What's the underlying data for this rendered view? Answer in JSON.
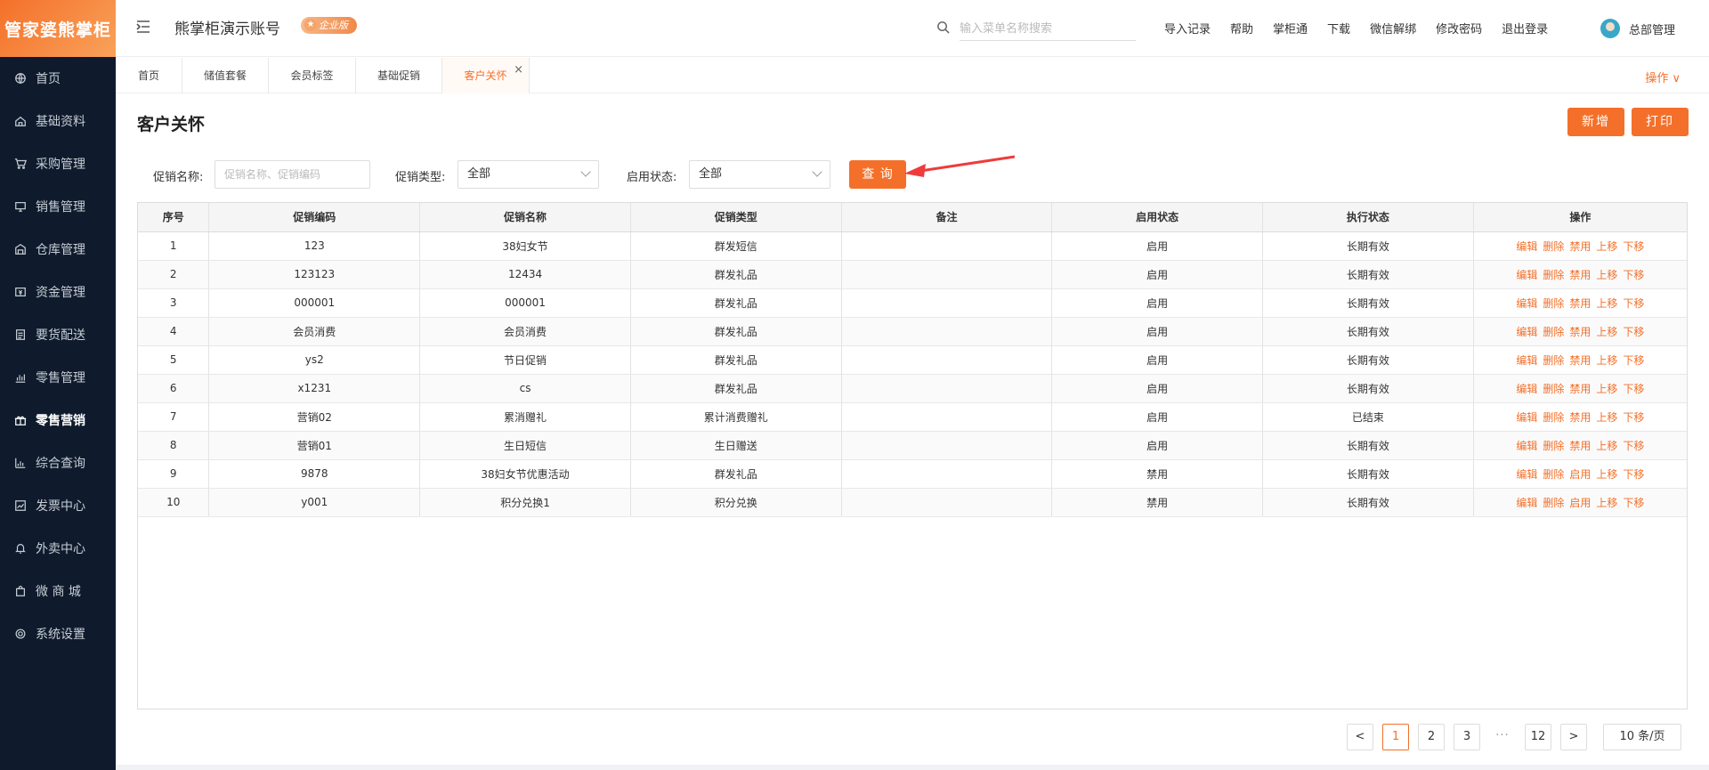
{
  "brand": {
    "logo_text": "管家婆熊掌柜",
    "accent": "#f4702a",
    "sidebar_bg": "#0f1b2d"
  },
  "sidebar": {
    "items": [
      {
        "label": "首页",
        "icon": "globe-icon",
        "active": false
      },
      {
        "label": "基础资料",
        "icon": "home-icon",
        "active": false
      },
      {
        "label": "采购管理",
        "icon": "cart-icon",
        "active": false
      },
      {
        "label": "销售管理",
        "icon": "monitor-icon",
        "active": false
      },
      {
        "label": "仓库管理",
        "icon": "warehouse-icon",
        "active": false
      },
      {
        "label": "资金管理",
        "icon": "money-icon",
        "active": false
      },
      {
        "label": "要货配送",
        "icon": "list-icon",
        "active": false
      },
      {
        "label": "零售管理",
        "icon": "chart-icon",
        "active": false
      },
      {
        "label": "零售营销",
        "icon": "gift-icon",
        "active": true
      },
      {
        "label": "综合查询",
        "icon": "bar-chart-icon",
        "active": false
      },
      {
        "label": "发票中心",
        "icon": "line-chart-icon",
        "active": false
      },
      {
        "label": "外卖中心",
        "icon": "bell-icon",
        "active": false
      },
      {
        "label": "微 商 城",
        "icon": "bag-icon",
        "active": false
      },
      {
        "label": "系统设置",
        "icon": "gear-icon",
        "active": false
      }
    ]
  },
  "header": {
    "account_name": "熊掌柜演示账号",
    "badge": "企业版",
    "search_placeholder": "输入菜单名称搜索",
    "links": [
      "导入记录",
      "帮助",
      "掌柜通",
      "下载",
      "微信解绑",
      "修改密码",
      "退出登录"
    ],
    "user_name": "总部管理"
  },
  "tabs": {
    "items": [
      {
        "label": "首页",
        "active": false
      },
      {
        "label": "储值套餐",
        "active": false
      },
      {
        "label": "会员标签",
        "active": false
      },
      {
        "label": "基础促销",
        "active": false
      },
      {
        "label": "客户关怀",
        "active": true
      }
    ],
    "close_glyph": "×",
    "ops_label": "操作 ∨"
  },
  "page": {
    "title": "客户关怀",
    "add_button": "新增",
    "print_button": "打印"
  },
  "filters": {
    "name_label": "促销名称:",
    "name_placeholder": "促销名称、促销编码",
    "type_label": "促销类型:",
    "type_value": "全部",
    "status_label": "启用状态:",
    "status_value": "全部",
    "query_button": "查 询"
  },
  "table": {
    "columns": [
      "序号",
      "促销编码",
      "促销名称",
      "促销类型",
      "备注",
      "启用状态",
      "执行状态",
      "操作"
    ],
    "rows": [
      {
        "no": "1",
        "code": "123",
        "name": "38妇女节",
        "type": "群发短信",
        "remark": "",
        "enabled": "启用",
        "exec": "长期有效",
        "actions": [
          "编辑",
          "删除",
          "禁用",
          "上移",
          "下移"
        ]
      },
      {
        "no": "2",
        "code": "123123",
        "name": "12434",
        "type": "群发礼品",
        "remark": "",
        "enabled": "启用",
        "exec": "长期有效",
        "actions": [
          "编辑",
          "删除",
          "禁用",
          "上移",
          "下移"
        ]
      },
      {
        "no": "3",
        "code": "000001",
        "name": "000001",
        "type": "群发礼品",
        "remark": "",
        "enabled": "启用",
        "exec": "长期有效",
        "actions": [
          "编辑",
          "删除",
          "禁用",
          "上移",
          "下移"
        ]
      },
      {
        "no": "4",
        "code": "会员消费",
        "name": "会员消费",
        "type": "群发礼品",
        "remark": "",
        "enabled": "启用",
        "exec": "长期有效",
        "actions": [
          "编辑",
          "删除",
          "禁用",
          "上移",
          "下移"
        ]
      },
      {
        "no": "5",
        "code": "ys2",
        "name": "节日促销",
        "type": "群发礼品",
        "remark": "",
        "enabled": "启用",
        "exec": "长期有效",
        "actions": [
          "编辑",
          "删除",
          "禁用",
          "上移",
          "下移"
        ]
      },
      {
        "no": "6",
        "code": "x1231",
        "name": "cs",
        "type": "群发礼品",
        "remark": "",
        "enabled": "启用",
        "exec": "长期有效",
        "actions": [
          "编辑",
          "删除",
          "禁用",
          "上移",
          "下移"
        ]
      },
      {
        "no": "7",
        "code": "营销02",
        "name": "累消赠礼",
        "type": "累计消费赠礼",
        "remark": "",
        "enabled": "启用",
        "exec": "已结束",
        "actions": [
          "编辑",
          "删除",
          "禁用",
          "上移",
          "下移"
        ]
      },
      {
        "no": "8",
        "code": "营销01",
        "name": "生日短信",
        "type": "生日赠送",
        "remark": "",
        "enabled": "启用",
        "exec": "长期有效",
        "actions": [
          "编辑",
          "删除",
          "禁用",
          "上移",
          "下移"
        ]
      },
      {
        "no": "9",
        "code": "9878",
        "name": "38妇女节优惠活动",
        "type": "群发礼品",
        "remark": "",
        "enabled": "禁用",
        "exec": "长期有效",
        "actions": [
          "编辑",
          "删除",
          "启用",
          "上移",
          "下移"
        ]
      },
      {
        "no": "10",
        "code": "y001",
        "name": "积分兑换1",
        "type": "积分兑换",
        "remark": "",
        "enabled": "禁用",
        "exec": "长期有效",
        "actions": [
          "编辑",
          "删除",
          "启用",
          "上移",
          "下移"
        ]
      }
    ]
  },
  "pagination": {
    "prev": "<",
    "pages": [
      "1",
      "2",
      "3"
    ],
    "ellipsis": "···",
    "last": "12",
    "next": ">",
    "current": "1",
    "page_size": "10 条/页"
  }
}
